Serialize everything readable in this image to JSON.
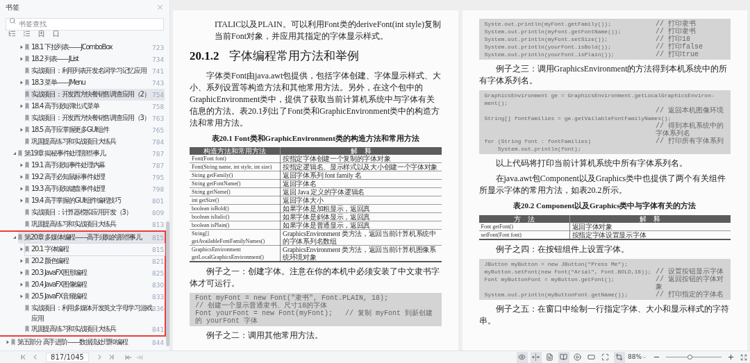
{
  "sidebar": {
    "title": "书签",
    "search": {
      "placeholder": "书签查找"
    },
    "tree": [
      {
        "children": [
          {
            "children": [
              {
                "label": "18.1  下拉列表——JComboBox",
                "page": "723",
                "expanded": false,
                "selected": false,
                "focused": false
              },
              {
                "label": "18.2  列表——JList",
                "page": "734",
                "expanded": false,
                "selected": false,
                "focused": false
              },
              {
                "label": "实战项目：利用列表开发名词学习记忆应用",
                "page": "741",
                "selected": false,
                "focused": false
              },
              {
                "label": "18.3  菜单——JMenu",
                "page": "743",
                "expanded": false,
                "selected": false,
                "focused": false
              },
              {
                "label": "实战项目：开发西方快餐销售调查应用（2）",
                "page": "754",
                "selected": true,
                "focused": false
              },
              {
                "label": "18.4  高手须知弹出式菜单",
                "page": "758",
                "expanded": false,
                "selected": false,
                "focused": false
              },
              {
                "label": "实战项目：开发西方快餐销售调查应用（3）",
                "page": "763",
                "selected": false,
                "focused": false
              },
              {
                "label": "18.5  高手应掌握更多GUI组件",
                "page": "765",
                "expanded": false,
                "selected": false,
                "focused": false
              },
              {
                "label": "巩固提高练习和实战项目大练兵",
                "page": "784",
                "selected": false,
                "focused": false
              }
            ]
          },
          {
            "label": "第19章  揭秘事件处理那些事儿",
            "page": "787",
            "expanded": true,
            "selected": false,
            "focused": false,
            "framed": false,
            "children": [
              {
                "label": "19.1  高手须知事件处理内幕",
                "page": "787",
                "expanded": false,
                "selected": false,
                "focused": false
              },
              {
                "label": "19.2  高手必知鼠标事件处理",
                "page": "795",
                "expanded": false,
                "selected": false,
                "focused": false
              },
              {
                "label": "19.3  高手须知键盘事件处理",
                "page": "798",
                "expanded": false,
                "selected": false,
                "focused": false
              },
              {
                "label": "19.4  高手掌握的GUI组件编程技巧",
                "page": "801",
                "expanded": false,
                "selected": false,
                "focused": false
              },
              {
                "label": "实战项目：计算器模拟应用开发（3）",
                "page": "809",
                "selected": false,
                "focused": false
              },
              {
                "label": "巩固提高练习和实战项目大练兵",
                "page": "813",
                "selected": false,
                "focused": false
              }
            ]
          },
          {
            "label": "第20章  多媒体编程——高手须知的那些事儿",
            "page": "815",
            "expanded": true,
            "selected": true,
            "focused": false,
            "framed": true,
            "children": [
              {
                "label": "20.1  字体编程",
                "page": "815",
                "expanded": false,
                "selected": false,
                "focused": true
              },
              {
                "label": "20.2  颜色编程",
                "page": "821",
                "expanded": false,
                "selected": false,
                "focused": false
              },
              {
                "label": "20.3  JavaFX图形编程",
                "page": "825",
                "expanded": false,
                "selected": false,
                "focused": false
              },
              {
                "label": "20.4  JavaFX图像编程",
                "page": "830",
                "expanded": false,
                "selected": false,
                "focused": false
              },
              {
                "label": "20.5  JavaFX音频编程",
                "page": "833",
                "expanded": false,
                "selected": false,
                "focused": false
              },
              {
                "label": "实战项目：利用多媒体开发英文字母学习游戏应用",
                "page": "836",
                "selected": false,
                "focused": false
              },
              {
                "label": "巩固提高练习和实战项目大练兵",
                "page": "841",
                "selected": false,
                "focused": false
              }
            ]
          }
        ]
      },
      {
        "label": "第五部分  高手进阶——数据流处理和编程",
        "page": "844",
        "expanded": false,
        "selected": false,
        "focused": false
      }
    ]
  },
  "pages": [
    {
      "blocks": [
        {
          "kind": "inset",
          "text": "ITALIC以及PLAIN。可以利用Font类的deriveFont(int    style)复制当前Font对象，并应用其指定的字体显示样式。"
        },
        {
          "kind": "heading",
          "number": "20.1.2",
          "text": "字体编程常用方法和举例"
        },
        {
          "kind": "para",
          "text": "字体类Font由java.awt包提供，包括字体创建、字体显示样式、大小、系列设置等构造方法和其他常用方法。另外，在这个包中的GraphicEnvironment类中，提供了获取当前计算机系统中与字体有关信息的方法。表20.1列出了Font类和GraphicEnvironment类中的构造方法和常用方法。"
        },
        {
          "kind": "caption",
          "text": "表20.1  Font类和GraphicEnvironment类的构造方法和常用方法"
        },
        {
          "kind": "table",
          "columns": [
            "构造方法和常用方法",
            "解　释"
          ],
          "rows": [
            [
              "Font(Font font)",
              "按指定字体创建一个复制的字体对象"
            ],
            [
              "Font(String name, int style, int size)",
              "按指定逻辑名、显示样式以及大小创建一个字体对象"
            ],
            [
              "String getFamily()",
              "返回字体系列 font family 名"
            ],
            [
              "String getFontName()",
              "返回字体名"
            ],
            [
              "String getName()",
              "返回 Java 定义的字体逻辑名"
            ],
            [
              "int getSize()",
              "返回字体大小"
            ],
            [
              "boolean isBold()",
              "如果字体是加粗显示，返回真"
            ],
            [
              "boolean isItalic()",
              "如果字体是斜体显示，返回真"
            ],
            [
              "boolean isPlain()",
              "如果字体是普通显示，返回真"
            ],
            [
              "String[] getAvailableFontFamilyNames()",
              "GraphicsEnvironment 类方法，返回当前计算机系统中的字体系列名数组"
            ],
            [
              "GraphicsEnvironment getLocalGraphicsEnvironment()",
              "GraphicsEnvironment 类方法，返回当前计算机图像系统环境对象"
            ]
          ]
        },
        {
          "kind": "para",
          "text": "例子之一：创建字体。注意在你的本机中必须安装了中文隶书字体才可运行。"
        },
        {
          "kind": "code",
          "lines": [
            {
              "code": "Font myFont = new Font(\"隶书\", Font.PLAIN, 18);"
            },
            {
              "code": "// 创建一个显示普通隶书、尺寸18的字体"
            },
            {
              "code": "Font yourFont = new Font(myFont);   // 复制 myFont 到新创建的 yourFont 字体"
            }
          ]
        },
        {
          "kind": "para",
          "text": "例子之二：调用其他常用方法。"
        }
      ]
    },
    {
      "blocks": [
        {
          "kind": "code",
          "lines": [
            {
              "code": "Syste.out.println(myFont.getFamily());",
              "comment": "// 打印隶书"
            },
            {
              "code": "System.out.println(myFont.getFontName());",
              "comment": "// 打印隶书"
            },
            {
              "code": "System.out.println(myFont.setSize());",
              "comment": "// 打印18"
            },
            {
              "code": "System.out.println(yourFont.isBold());",
              "comment": "// 打印false"
            },
            {
              "code": "System.out.println(yourFont.isPlain());",
              "comment": "// 打印true"
            }
          ]
        },
        {
          "kind": "para",
          "text": "例子之三：调用GraphicsEnvironment的方法得到本机系统中的所有字体系列名。"
        },
        {
          "kind": "code",
          "lines": [
            {
              "code": "GraphicsEnvironment ge = GraphicsEnvironment.getLocalGraphicsEnviron- ment();"
            },
            {
              "comment": "// 返回本机图像环境"
            },
            {
              "code": "String[] fontFamilies = ge.getVailableFontFamilyNames();"
            },
            {
              "comment": "// 得到本机系统中的字体系列名"
            },
            {
              "code": "for (String font : fontFamilies)",
              "comment": "// 打印所有字体系列"
            },
            {
              "code": "    System.out.println(font);"
            }
          ]
        },
        {
          "kind": "para",
          "text": "以上代码将打印当前计算机系统中所有字体系列名。"
        },
        {
          "kind": "para",
          "text": "在java.awt包Component以及Graphics类中也提供了两个有关组件所显示字体的常用方法，如表20.2所示。"
        },
        {
          "kind": "caption",
          "text": "表20.2  Component以及Graphics类中与字体有关的方法"
        },
        {
          "kind": "table",
          "columns": [
            "方　法",
            "解　释"
          ],
          "rows": [
            [
              "Font getFont()",
              "返回字体对象"
            ],
            [
              "setFont(Font font)",
              "按指定字体设置显示字体"
            ]
          ]
        },
        {
          "kind": "para",
          "text": "例子之四：在按钮组件上设置字体。"
        },
        {
          "kind": "code",
          "lines": [
            {
              "code": "JButton myButton = new JButton(\"Press Me\");"
            },
            {
              "code": "myButton.setFont(new Font(\"Arial\", Font.BOLD,16));",
              "comment": "// 设置按钮显示字体"
            },
            {
              "code": "Font myButtonFont = myButton.getFont();",
              "comment": "// 返回按钮的字体对象"
            },
            {
              "code": "System.out.println(myButtonFont.getName());",
              "comment": "// 打印指定的字体名"
            }
          ]
        },
        {
          "kind": "para",
          "text": "例子之五：在窗口中绘制一行指定字体、大小和显示样式的字符串。"
        }
      ]
    }
  ],
  "bottom_bar": {
    "page_field": "817/1045",
    "view_tools": [
      {
        "kind": "read_mode",
        "selected": true
      },
      {
        "kind": "fit_width",
        "selected": true
      },
      {
        "kind": "single_page",
        "selected": false
      },
      {
        "kind": "double_page",
        "selected": true
      },
      {
        "kind": "play",
        "selected": false
      },
      {
        "kind": "actual_size",
        "selected": false
      },
      {
        "kind": "fit_page",
        "selected": false
      },
      {
        "kind": "fit_visible",
        "selected": true
      }
    ],
    "zoom": {
      "value": "88%",
      "level": 0.43
    }
  }
}
